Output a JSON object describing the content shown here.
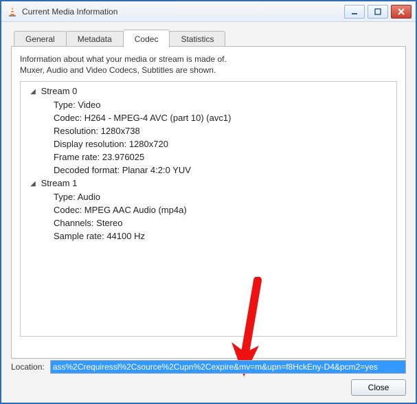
{
  "window": {
    "title": "Current Media Information"
  },
  "tabs": [
    {
      "label": "General"
    },
    {
      "label": "Metadata"
    },
    {
      "label": "Codec"
    },
    {
      "label": "Statistics"
    }
  ],
  "active_tab": 2,
  "codec_page": {
    "info_line1": "Information about what your media or stream is made of.",
    "info_line2": "Muxer, Audio and Video Codecs, Subtitles are shown.",
    "streams": [
      {
        "header": "Stream 0",
        "props": [
          "Type: Video",
          "Codec: H264 - MPEG-4 AVC (part 10) (avc1)",
          "Resolution: 1280x738",
          "Display resolution: 1280x720",
          "Frame rate: 23.976025",
          "Decoded format: Planar 4:2:0 YUV"
        ]
      },
      {
        "header": "Stream 1",
        "props": [
          "Type: Audio",
          "Codec: MPEG AAC Audio (mp4a)",
          "Channels: Stereo",
          "Sample rate: 44100 Hz"
        ]
      }
    ]
  },
  "location": {
    "label": "Location:",
    "value": "ass%2Crequiressl%2Csource%2Cupn%2Cexpire&mv=m&upn=f8HckEny-D4&pcm2=yes"
  },
  "buttons": {
    "close": "Close"
  }
}
